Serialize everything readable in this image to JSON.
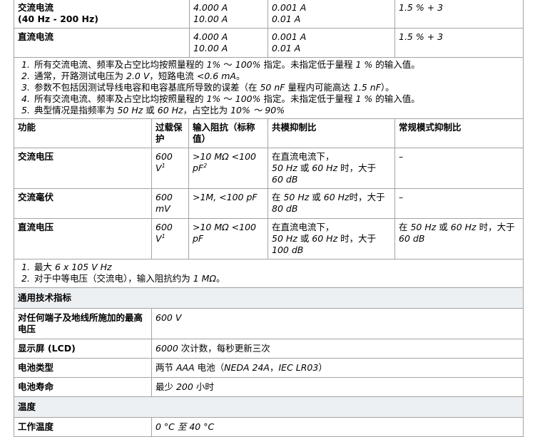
{
  "current": {
    "rows": [
      {
        "func": "交流电流",
        "func2": "(40 Hz - 200 Hz)",
        "r1": "4.000 A",
        "r2": "10.00 A",
        "s1": "0.001 A",
        "s2": "0.01 A",
        "acc": "1.5 % + 3"
      },
      {
        "func": "直流电流",
        "r1": "4.000 A",
        "r2": "10.00 A",
        "s1": "0.001 A",
        "s2": "0.01 A",
        "acc": "1.5 % + 3"
      }
    ]
  },
  "notes1": [
    {
      "a": "所有交流电流、频率及占空比均按照量程的 ",
      "b": "1%",
      "c": " ～ ",
      "d": "100%",
      "e": " 指定。未指定低于量程 ",
      "f": "1 %",
      "g": " 的输入值。"
    },
    {
      "a": "通常，开路测试电压为 ",
      "b": "2.0 V",
      "c": "，短路电流 ",
      "d": "<0.6 mA",
      "e": "。"
    },
    {
      "a": "参数不包括因测试导线电容和电容基底所导致的误差（在 ",
      "b": "50 nF",
      "c": " 量程内可能高达 ",
      "d": "1.5 nF",
      "e": "）。"
    },
    {
      "a": "所有交流电流、频率及占空比均按照量程的 ",
      "b": "1%",
      "c": " ～ ",
      "d": "100%",
      "e": " 指定。未指定低于量程 ",
      "f": "1 %",
      "g": " 的输入值。"
    },
    {
      "a": "典型情况是指频率为 ",
      "b": "50 Hz",
      "c": " 或 ",
      "d": "60 Hz",
      "e": "，占空比为 ",
      "f": "10% ～ 90%"
    }
  ],
  "voltage": {
    "headers": [
      "功能",
      "过载保护",
      "输入阻抗（标称值）",
      "共模抑制比",
      "常规模式抑制比"
    ],
    "rows": [
      {
        "func": "交流电压",
        "ov1": "600",
        "ov2": "V",
        "ov_sup": "1",
        "imp1": ">10 MΩ <100",
        "imp2": "pF",
        "imp_sup": "2",
        "cm1": "在直流电流下，",
        "cm2a": "50 Hz",
        "cm2b": " 或 ",
        "cm2c": "60 Hz",
        "cm2d": " 时，大于",
        "cm3": "60 dB",
        "nm": "–"
      },
      {
        "func": "交流毫伏",
        "ov1": "600",
        "ov2": "mV",
        "imp1": ">1M, <100 pF",
        "cm1a": "在 ",
        "cm1b": "50 Hz",
        "cm1c": " 或 ",
        "cm1d": "60 Hz",
        "cm1e": "时，大于",
        "cm2": "80 dB",
        "nm": "–"
      },
      {
        "func": "直流电压",
        "ov1": "600",
        "ov2": "V",
        "ov_sup": "1",
        "imp1": ">10 MΩ <100",
        "imp2": "pF",
        "cm1": "在直流电流下，",
        "cm2a": "50 Hz",
        "cm2b": " 或 ",
        "cm2c": "60 Hz",
        "cm2d": " 时，大于",
        "cm3": "100 dB",
        "nm1a": "在 ",
        "nm1b": "50 Hz",
        "nm1c": " 或 ",
        "nm1d": "60 Hz",
        "nm1e": " 时，大于",
        "nm2": "60 dB"
      }
    ]
  },
  "notes2": [
    {
      "a": "最大 ",
      "b": "6 x 105 V Hz"
    },
    {
      "a": "对于中等电压（交流电），输入阻抗约为 ",
      "b": "1 MΩ",
      "c": "。"
    }
  ],
  "general": {
    "title": "通用技术指标",
    "rows": [
      {
        "label": "对任何端子及地线所施加的最高电压",
        "value": "600 V"
      },
      {
        "label": "显示屏 (LCD)",
        "v1": "6000",
        "v2": " 次计数，每秒更新三次"
      },
      {
        "label": "电池类型",
        "v1": "两节 ",
        "v2": "AAA",
        "v3": " 电池（",
        "v4": "NEDA 24A",
        "v5": "，",
        "v6": "IEC LR03",
        "v7": "）"
      },
      {
        "label": "电池寿命",
        "v1": "最少 ",
        "v2": "200",
        "v3": " 小时"
      }
    ]
  },
  "temperature": {
    "title": "温度",
    "rows": [
      {
        "label": "工作温度",
        "value": "0 °C 至 40 °C"
      }
    ]
  }
}
